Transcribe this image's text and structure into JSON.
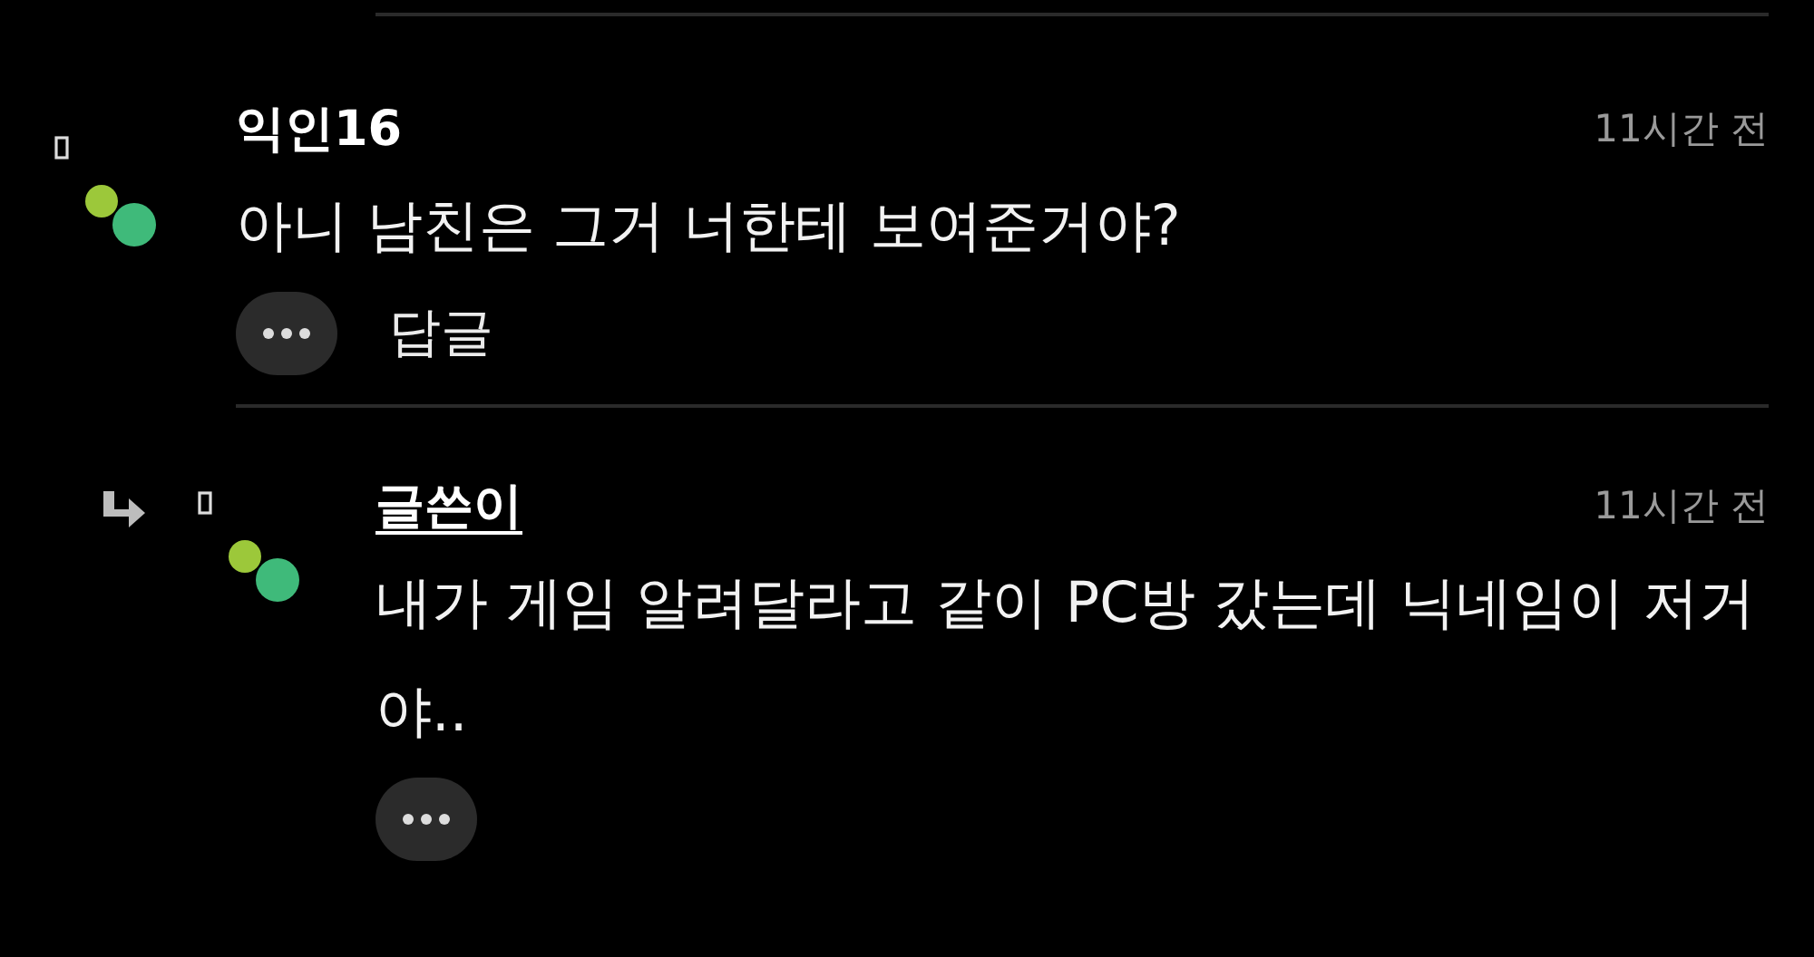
{
  "comments": [
    {
      "kind": "comment",
      "author": "익인16",
      "author_underlined": false,
      "time": "11시간 전",
      "text": "아니 남친은 그거 너한테 보여준거야?",
      "reply_label": "답글"
    },
    {
      "kind": "reply",
      "author": "글쓴이",
      "author_underlined": true,
      "time": "11시간 전",
      "text": "내가 게임 알려달라고 같이 PC방 갔는데 닉네임이 저거야.."
    }
  ]
}
